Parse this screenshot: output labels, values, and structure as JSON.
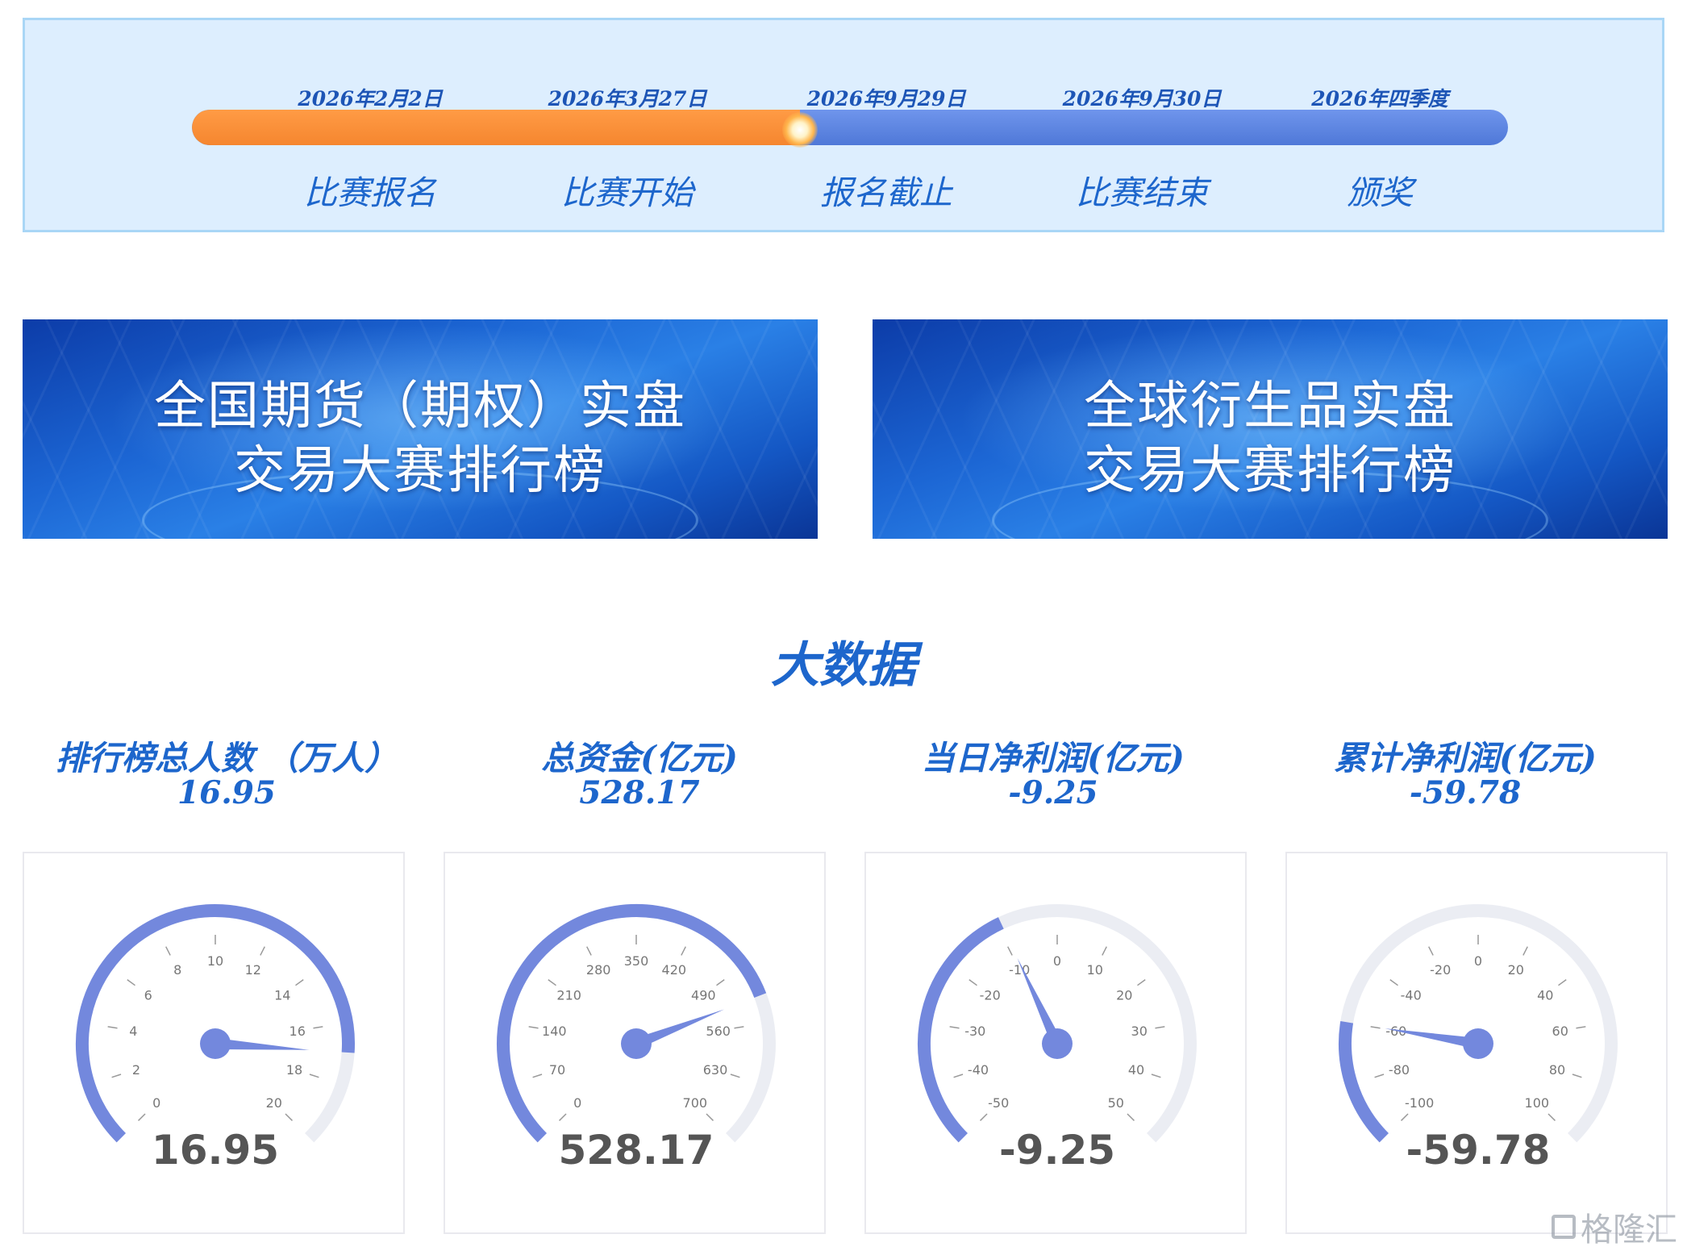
{
  "timeline": {
    "progress": 0.462,
    "milestones": [
      {
        "date": "2026年2月2日",
        "label": "比赛报名"
      },
      {
        "date": "2026年3月27日",
        "label": "比赛开始"
      },
      {
        "date": "2026年9月29日",
        "label": "报名截止"
      },
      {
        "date": "2026年9月30日",
        "label": "比赛结束"
      },
      {
        "date": "2026年四季度",
        "label": "颁奖"
      }
    ]
  },
  "banners": [
    {
      "line1": "全国期货（期权）实盘",
      "line2": "交易大赛排行榜"
    },
    {
      "line1": "全球衍生品实盘",
      "line2": "交易大赛排行榜"
    }
  ],
  "section_title": "大数据",
  "stats": [
    {
      "label": "排行榜总人数 （万人）",
      "value": "16.95"
    },
    {
      "label": "总资金(亿元)",
      "value": "528.17"
    },
    {
      "label": "当日净利润(亿元)",
      "value": "-9.25"
    },
    {
      "label": "累计净利润(亿元)",
      "value": "-59.78"
    }
  ],
  "colors": {
    "accent": "#1d66cc",
    "gauge_fill": "#7388dd",
    "gauge_track": "#ebedf3",
    "progress_done": "#f5862f",
    "progress_remaining": "#5b82de"
  },
  "watermark": "格隆汇",
  "chart_data": [
    {
      "type": "gauge",
      "min": 0,
      "max": 20,
      "value": 16.95,
      "display": "16.95",
      "ticks": [
        0,
        2,
        4,
        6,
        8,
        10,
        12,
        14,
        16,
        18,
        20
      ]
    },
    {
      "type": "gauge",
      "min": 0,
      "max": 700,
      "value": 528.17,
      "display": "528.17",
      "ticks": [
        0,
        70,
        140,
        210,
        280,
        350,
        420,
        490,
        560,
        630,
        700
      ]
    },
    {
      "type": "gauge",
      "min": -50,
      "max": 50,
      "value": -9.25,
      "display": "-9.25",
      "ticks": [
        -50,
        -40,
        -30,
        -20,
        -10,
        0,
        10,
        20,
        30,
        40,
        50
      ]
    },
    {
      "type": "gauge",
      "min": -100,
      "max": 100,
      "value": -59.78,
      "display": "-59.78",
      "ticks": [
        -100,
        -80,
        -60,
        -40,
        -20,
        0,
        20,
        40,
        60,
        80,
        100
      ]
    }
  ]
}
